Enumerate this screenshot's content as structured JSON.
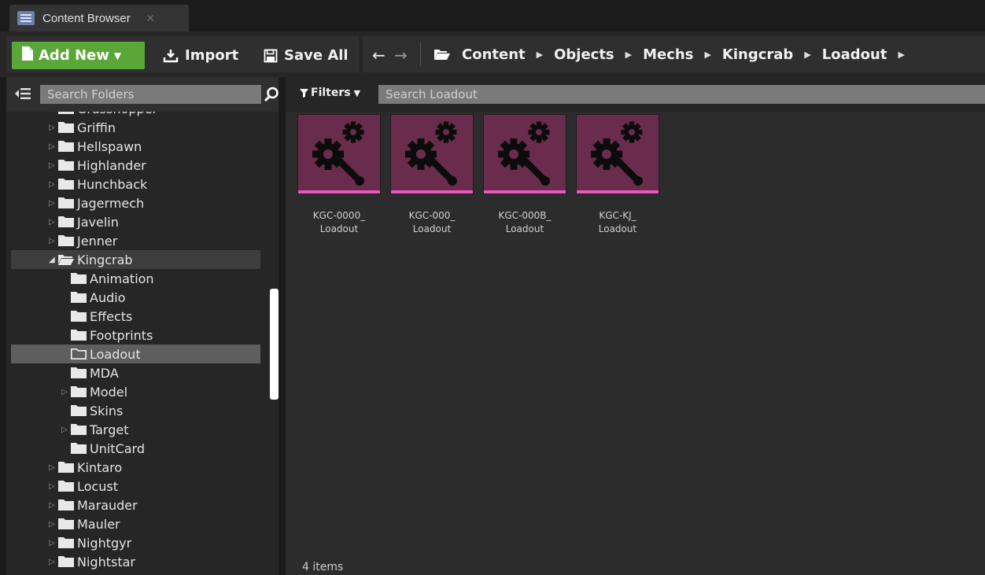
{
  "window": {
    "tab_label": "Content Browser",
    "tab_close": "×"
  },
  "toolbar": {
    "add_new_label": "Add New",
    "import_label": "Import",
    "save_all_label": "Save All",
    "accent_color": "#5aa637"
  },
  "breadcrumb": [
    "Content",
    "Objects",
    "Mechs",
    "Kingcrab",
    "Loadout"
  ],
  "folder_search": {
    "placeholder": "Search Folders"
  },
  "folder_tree": [
    {
      "label": "Grasshopper",
      "expandable": true,
      "depth": 0
    },
    {
      "label": "Griffin",
      "expandable": true,
      "depth": 0
    },
    {
      "label": "Hellspawn",
      "expandable": true,
      "depth": 0
    },
    {
      "label": "Highlander",
      "expandable": true,
      "depth": 0
    },
    {
      "label": "Hunchback",
      "expandable": true,
      "depth": 0
    },
    {
      "label": "Jagermech",
      "expandable": true,
      "depth": 0
    },
    {
      "label": "Javelin",
      "expandable": true,
      "depth": 0
    },
    {
      "label": "Jenner",
      "expandable": true,
      "depth": 0
    },
    {
      "label": "Kingcrab",
      "expandable": true,
      "expanded": true,
      "depth": 0
    },
    {
      "label": "Animation",
      "expandable": false,
      "depth": 1
    },
    {
      "label": "Audio",
      "expandable": false,
      "depth": 1
    },
    {
      "label": "Effects",
      "expandable": false,
      "depth": 1
    },
    {
      "label": "Footprints",
      "expandable": false,
      "depth": 1
    },
    {
      "label": "Loadout",
      "expandable": false,
      "selected": true,
      "depth": 1
    },
    {
      "label": "MDA",
      "expandable": false,
      "depth": 1
    },
    {
      "label": "Model",
      "expandable": true,
      "depth": 1
    },
    {
      "label": "Skins",
      "expandable": false,
      "depth": 1
    },
    {
      "label": "Target",
      "expandable": true,
      "depth": 1
    },
    {
      "label": "UnitCard",
      "expandable": false,
      "depth": 1
    },
    {
      "label": "Kintaro",
      "expandable": true,
      "depth": 0
    },
    {
      "label": "Locust",
      "expandable": true,
      "depth": 0
    },
    {
      "label": "Marauder",
      "expandable": true,
      "depth": 0
    },
    {
      "label": "Mauler",
      "expandable": true,
      "depth": 0
    },
    {
      "label": "Nightgyr",
      "expandable": true,
      "depth": 0
    },
    {
      "label": "Nightstar",
      "expandable": true,
      "depth": 0
    }
  ],
  "filters": {
    "label": "Filters"
  },
  "asset_search": {
    "placeholder": "Search Loadout"
  },
  "assets": [
    {
      "name_line1": "KGC-0000_",
      "name_line2": "Loadout",
      "icon": "gear-wrench-icon"
    },
    {
      "name_line1": "KGC-000_",
      "name_line2": "Loadout",
      "icon": "gear-wrench-icon"
    },
    {
      "name_line1": "KGC-000B_",
      "name_line2": "Loadout",
      "icon": "gear-wrench-icon"
    },
    {
      "name_line1": "KGC-KJ_",
      "name_line2": "Loadout",
      "icon": "gear-wrench-icon"
    }
  ],
  "asset_colors": {
    "thumbnail": "#6a2c4c",
    "stripe": "#e85ac0"
  },
  "status": {
    "item_count": "4 items"
  }
}
